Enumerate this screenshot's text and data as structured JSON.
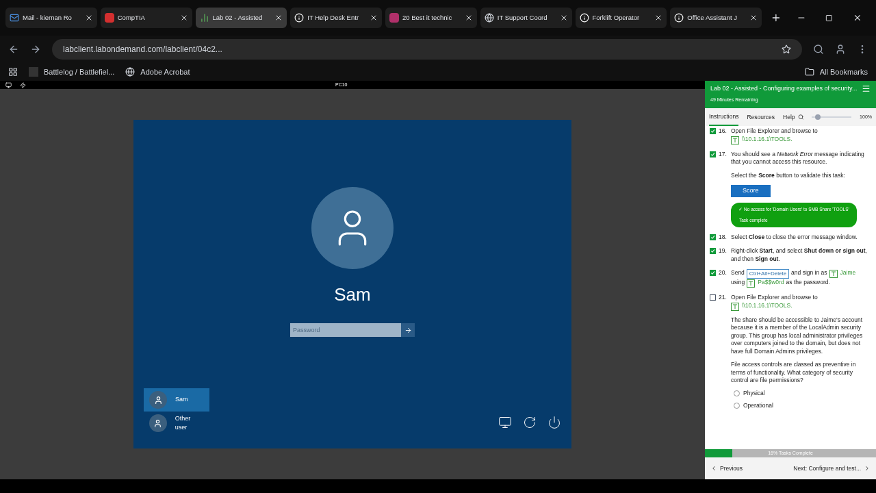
{
  "browser": {
    "tabs": [
      {
        "label": "Mail - kiernan Ro",
        "selected": false
      },
      {
        "label": "CompTIA",
        "selected": false
      },
      {
        "label": "Lab 02 - Assisted",
        "selected": true
      },
      {
        "label": "IT Help Desk Entr",
        "selected": false
      },
      {
        "label": "20 Best it technic",
        "selected": false
      },
      {
        "label": "IT Support Coord",
        "selected": false
      },
      {
        "label": "Forklift Operator",
        "selected": false
      },
      {
        "label": "Office Assistant J",
        "selected": false
      }
    ],
    "url": "labclient.labondemand.com/labclient/04c2...",
    "bookmarks": [
      {
        "label": "Battlelog / Battlefiel..."
      },
      {
        "label": "Adobe Acrobat"
      }
    ],
    "all_bookmarks": "All Bookmarks"
  },
  "vm_toolbar": {
    "title": "PC10"
  },
  "lock_screen": {
    "user_name": "Sam",
    "password_placeholder": "Password",
    "users": [
      {
        "name": "Sam",
        "selected": true
      },
      {
        "name": "Other user",
        "selected": false
      }
    ]
  },
  "lab_panel": {
    "title": "Lab 02 - Assisted - Configuring examples of security...",
    "time_remaining": "49 Minutes Remaining",
    "tabs": [
      {
        "label": "Instructions",
        "selected": true
      },
      {
        "label": "Resources",
        "selected": false
      },
      {
        "label": "Help",
        "selected": false
      }
    ],
    "zoom": {
      "level": 0.15,
      "reading": "100%"
    },
    "tasks": [
      {
        "number": "16.",
        "checked": true,
        "parts": [
          {
            "kind": "text",
            "text": "Open File Explorer and browse to"
          },
          {
            "kind": "typable",
            "text": "\\\\10.1.16.1\\TOOLS."
          }
        ]
      },
      {
        "number": "17.",
        "checked": true,
        "parts": [
          {
            "kind": "text",
            "text": "You should see a *Network Error* message indicating that you cannot access this resource."
          }
        ],
        "notes": [
          {
            "kind": "paragraph",
            "text": "Select the **Score** button to validate this task:"
          },
          {
            "kind": "score_button",
            "text": "Score"
          },
          {
            "kind": "result",
            "text": "✓ No access for 'Domain Users' to SMB Share 'TOOLS'",
            "detail": "Task complete"
          }
        ]
      },
      {
        "number": "18.",
        "checked": true,
        "parts": [
          {
            "kind": "text",
            "text": "Select **Close** to close the error message window."
          }
        ]
      },
      {
        "number": "19.",
        "checked": true,
        "parts": [
          {
            "kind": "text",
            "text": "Right-click **Start**, and select **Shut down or sign out**, and then **Sign out**."
          }
        ]
      },
      {
        "number": "20.",
        "checked": true,
        "parts": [
          {
            "kind": "text",
            "text": "Send"
          },
          {
            "kind": "key",
            "text": "Ctrl+Alt+Delete"
          },
          {
            "kind": "text",
            "text": "and sign in as"
          },
          {
            "kind": "typable",
            "text": "Jaime"
          },
          {
            "kind": "text",
            "text": "using"
          },
          {
            "kind": "typable",
            "text": "Pa$$w0rd"
          },
          {
            "kind": "text",
            "text": "as the password."
          }
        ]
      },
      {
        "number": "21.",
        "checked": false,
        "parts": [
          {
            "kind": "text",
            "text": "Open File Explorer and browse to"
          },
          {
            "kind": "typable",
            "text": "\\\\10.1.16.1\\TOOLS."
          }
        ],
        "notes": [
          {
            "kind": "paragraph",
            "text": "The share should be accessible to Jaime's account because it is a member of the LocalAdmin security group. This group has local administrator privileges over computers joined to the domain, but does not have full Domain Admins privileges."
          },
          {
            "kind": "paragraph",
            "text": "File access controls are classed as preventive in terms of functionality. What category of security control are file permissions?"
          },
          {
            "kind": "radio",
            "text": "Physical",
            "selected": false
          },
          {
            "kind": "radio",
            "text": "Operational",
            "selected": false
          }
        ]
      }
    ],
    "progress": {
      "level": 0.16,
      "reading": "16% Tasks Complete"
    },
    "previous": "Previous",
    "next": "Next: Configure and test..."
  }
}
